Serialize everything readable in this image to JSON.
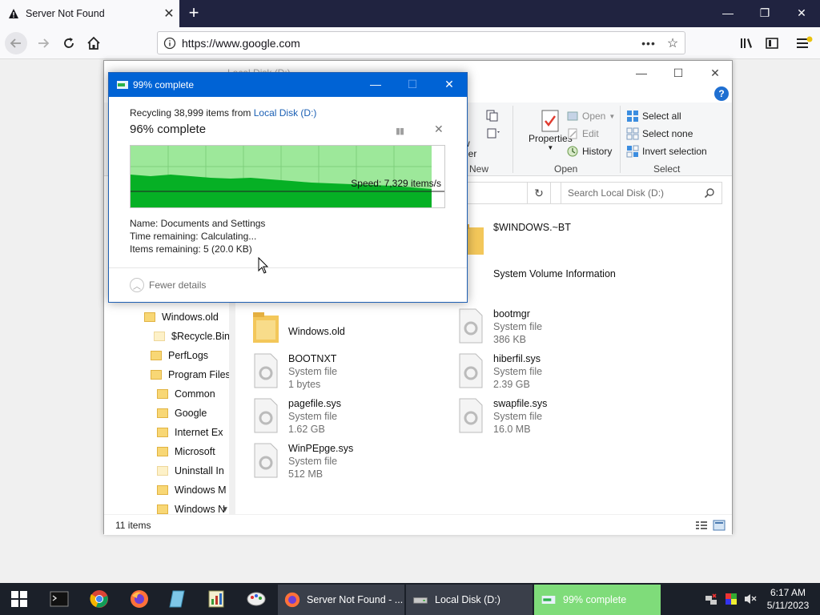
{
  "browser": {
    "tab_title": "Server Not Found",
    "url": "https://www.google.com"
  },
  "explorer": {
    "title": "Local Disk (D:)",
    "ribbon": {
      "new_label": "New",
      "new_folder_fragment": "w",
      "new_folder_fragment2": "der",
      "properties_label": "Properties",
      "open_label": "Open",
      "edit_label": "Edit",
      "history_label": "History",
      "open_group_label": "Open",
      "select_all_label": "Select all",
      "select_none_label": "Select none",
      "invert_selection_label": "Invert selection",
      "select_group_label": "Select"
    },
    "search_placeholder": "Search Local Disk (D:)",
    "nav_items": [
      {
        "label": "Windows.old"
      },
      {
        "label": "$Recycle.Bin"
      },
      {
        "label": "PerfLogs"
      },
      {
        "label": "Program Files"
      },
      {
        "label": "Common"
      },
      {
        "label": "Google"
      },
      {
        "label": "Internet Ex"
      },
      {
        "label": "Microsoft"
      },
      {
        "label": "Uninstall In"
      },
      {
        "label": "Windows M"
      },
      {
        "label": "Windows N"
      }
    ],
    "files": [
      {
        "name": "$WINDOWS.~BT",
        "type": "",
        "size": ""
      },
      {
        "name": "System Volume Information",
        "type": "",
        "size": ""
      },
      {
        "name": "Windows.old",
        "type": "",
        "size": ""
      },
      {
        "name": "bootmgr",
        "type": "System file",
        "size": "386 KB"
      },
      {
        "name": "BOOTNXT",
        "type": "System file",
        "size": "1 bytes"
      },
      {
        "name": "hiberfil.sys",
        "type": "System file",
        "size": "2.39 GB"
      },
      {
        "name": "pagefile.sys",
        "type": "System file",
        "size": "1.62 GB"
      },
      {
        "name": "swapfile.sys",
        "type": "System file",
        "size": "16.0 MB"
      },
      {
        "name": "WinPEpge.sys",
        "type": "System file",
        "size": "512 MB"
      }
    ],
    "status_count": "11 items"
  },
  "dialog": {
    "title": "99% complete",
    "line_prefix": "Recycling 38,999 items from ",
    "line_link": "Local Disk (D:)",
    "percent_text": "96% complete",
    "progress_fraction": 0.96,
    "speed": "Speed: 7,329 items/s",
    "name_line": "Name:  Documents and Settings",
    "time_line": "Time remaining:  Calculating...",
    "items_line": "Items remaining:  5 (20.0 KB)",
    "fewer_details": "Fewer details"
  },
  "taskbar": {
    "tasks": [
      {
        "label": "Server Not Found - ..."
      },
      {
        "label": "Local Disk (D:)"
      },
      {
        "label": "99% complete"
      }
    ],
    "time": "6:17 AM",
    "date": "5/11/2023"
  },
  "colors": {
    "accent_blue": "#0063d5",
    "progress_green": "#06b025",
    "progress_light": "#9de89a",
    "taskbar_bg": "#1b2029"
  }
}
